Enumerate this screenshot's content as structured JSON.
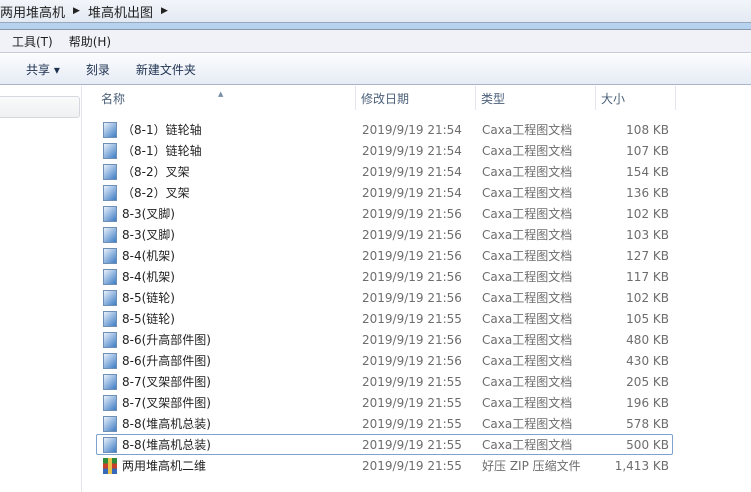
{
  "breadcrumb": [
    "两用堆高机",
    "堆高机出图"
  ],
  "menu": [
    "工具(T)",
    "帮助(H)"
  ],
  "toolbar": {
    "share": "共享 ▾",
    "burn": "刻录",
    "new_folder": "新建文件夹"
  },
  "columns": [
    "名称",
    "修改日期",
    "类型",
    "大小"
  ],
  "files": [
    {
      "name": "（8-1）链轮轴",
      "date": "2019/9/19 21:54",
      "type": "Caxa工程图文档",
      "size": "108 KB",
      "icon": "caxa-file-icon"
    },
    {
      "name": "（8-1）链轮轴",
      "date": "2019/9/19 21:54",
      "type": "Caxa工程图文档",
      "size": "107 KB",
      "icon": "caxa-file-icon"
    },
    {
      "name": "（8-2）叉架",
      "date": "2019/9/19 21:54",
      "type": "Caxa工程图文档",
      "size": "154 KB",
      "icon": "caxa-file-icon"
    },
    {
      "name": "（8-2）叉架",
      "date": "2019/9/19 21:54",
      "type": "Caxa工程图文档",
      "size": "136 KB",
      "icon": "caxa-file-icon"
    },
    {
      "name": "8-3(叉脚)",
      "date": "2019/9/19 21:56",
      "type": "Caxa工程图文档",
      "size": "102 KB",
      "icon": "caxa-file-icon"
    },
    {
      "name": "8-3(叉脚)",
      "date": "2019/9/19 21:56",
      "type": "Caxa工程图文档",
      "size": "103 KB",
      "icon": "caxa-file-icon"
    },
    {
      "name": "8-4(机架)",
      "date": "2019/9/19 21:56",
      "type": "Caxa工程图文档",
      "size": "127 KB",
      "icon": "caxa-file-icon"
    },
    {
      "name": "8-4(机架)",
      "date": "2019/9/19 21:56",
      "type": "Caxa工程图文档",
      "size": "117 KB",
      "icon": "caxa-file-icon"
    },
    {
      "name": "8-5(链轮)",
      "date": "2019/9/19 21:56",
      "type": "Caxa工程图文档",
      "size": "102 KB",
      "icon": "caxa-file-icon"
    },
    {
      "name": "8-5(链轮)",
      "date": "2019/9/19 21:55",
      "type": "Caxa工程图文档",
      "size": "105 KB",
      "icon": "caxa-file-icon"
    },
    {
      "name": "8-6(升高部件图)",
      "date": "2019/9/19 21:56",
      "type": "Caxa工程图文档",
      "size": "480 KB",
      "icon": "caxa-file-icon"
    },
    {
      "name": "8-6(升高部件图)",
      "date": "2019/9/19 21:56",
      "type": "Caxa工程图文档",
      "size": "430 KB",
      "icon": "caxa-file-icon"
    },
    {
      "name": "8-7(叉架部件图)",
      "date": "2019/9/19 21:55",
      "type": "Caxa工程图文档",
      "size": "205 KB",
      "icon": "caxa-file-icon"
    },
    {
      "name": "8-7(叉架部件图)",
      "date": "2019/9/19 21:55",
      "type": "Caxa工程图文档",
      "size": "196 KB",
      "icon": "caxa-file-icon"
    },
    {
      "name": "8-8(堆高机总装)",
      "date": "2019/9/19 21:55",
      "type": "Caxa工程图文档",
      "size": "578 KB",
      "icon": "caxa-file-icon"
    },
    {
      "name": "8-8(堆高机总装)",
      "date": "2019/9/19 21:55",
      "type": "Caxa工程图文档",
      "size": "500 KB",
      "icon": "caxa-file-icon",
      "selected": true
    },
    {
      "name": "两用堆高机二维",
      "date": "2019/9/19 21:55",
      "type": "好压 ZIP 压缩文件",
      "size": "1,413 KB",
      "icon": "zip-archive-icon"
    }
  ]
}
